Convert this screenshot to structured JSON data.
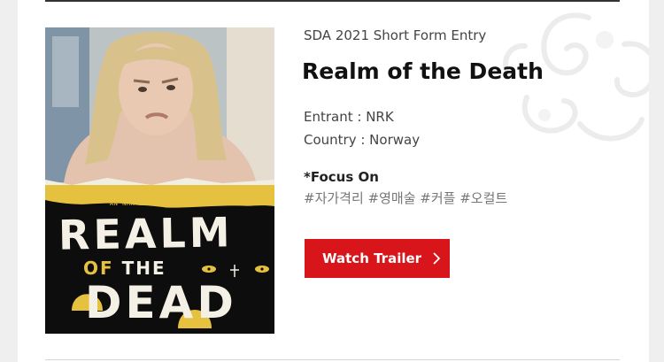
{
  "entry": {
    "category": "SDA 2021 Short Form Entry",
    "title": "Realm of the Death",
    "entrant": "Entrant : NRK",
    "country": "Country : Norway",
    "focus_label": "*Focus On",
    "tags": "#자가격리 #영매술 #커플 #오컬트",
    "watch_button": "Watch Trailer"
  },
  "poster": {
    "tagline": "AN NRK SHORT FORM SERIES",
    "title_line1": "REALM",
    "title_line2_a": "OF",
    "title_line2_b": "THE",
    "title_line3": "DEAD"
  },
  "colors": {
    "accent_red": "#d7151b",
    "poster_yellow": "#e6c13f"
  }
}
